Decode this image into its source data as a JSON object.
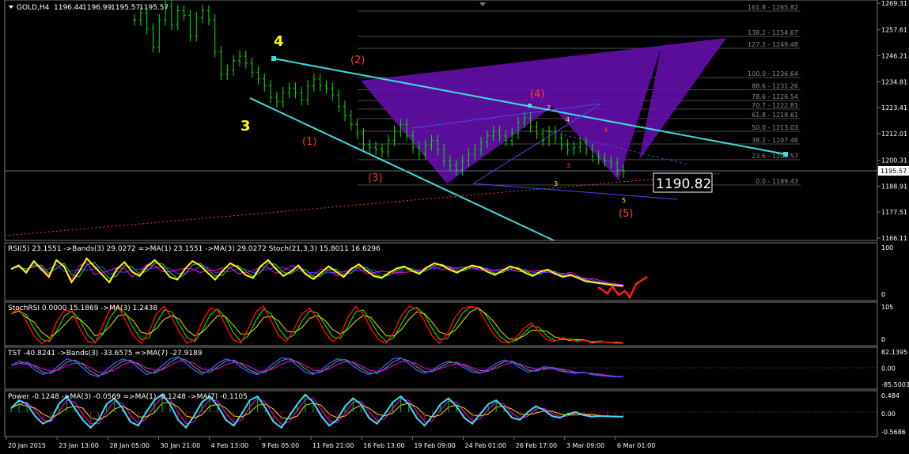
{
  "chart_data": {
    "type": "line",
    "symbol": "GOLD,H4",
    "header": {
      "title": "GOLD,H4",
      "ohlc": [
        "1196.44",
        "1196.99",
        "1195.57",
        "1195.57"
      ]
    },
    "price_axis": {
      "ylim": [
        1166.11,
        1269.31
      ],
      "ticks": [
        "1269.31",
        "1257.61",
        "1246.21",
        "1234.81",
        "1223.41",
        "1212.01",
        "1200.31",
        "1188.91",
        "1177.51",
        "1166.11"
      ]
    },
    "current_price": "1195.57",
    "big_price_label": "1190.82",
    "fib_levels": [
      {
        "label": "161.8 - 1265.82",
        "value": 1265.82
      },
      {
        "label": "138.2 - 1254.67",
        "value": 1254.67
      },
      {
        "label": "127.2 - 1249.48",
        "value": 1249.48
      },
      {
        "label": "100.0 - 1236.64",
        "value": 1236.64
      },
      {
        "label": "88.6 - 1231.26",
        "value": 1231.26
      },
      {
        "label": "78.6 - 1226.54",
        "value": 1226.54
      },
      {
        "label": "70.7 - 1222.81",
        "value": 1222.81
      },
      {
        "label": "61.8 - 1218.61",
        "value": 1218.61
      },
      {
        "label": "50.0 - 1213.03",
        "value": 1213.03
      },
      {
        "label": "38.2 - 1207.46",
        "value": 1207.46
      },
      {
        "label": "23.6 - 1200.57",
        "value": 1200.57
      },
      {
        "label": "0.0 - 1189.43",
        "value": 1189.43
      }
    ],
    "price_series": [
      1262,
      1265,
      1258,
      1250,
      1262,
      1268,
      1260,
      1266,
      1264,
      1255,
      1263,
      1266,
      1262,
      1248,
      1238,
      1240,
      1244,
      1246,
      1243,
      1239,
      1236,
      1233,
      1228,
      1226,
      1230,
      1232,
      1230,
      1227,
      1233,
      1236,
      1233,
      1232,
      1229,
      1224,
      1220,
      1216,
      1212,
      1207,
      1206,
      1205,
      1204,
      1209,
      1213,
      1216,
      1211,
      1206,
      1203,
      1207,
      1209,
      1205,
      1200,
      1198,
      1196,
      1200,
      1203,
      1205,
      1208,
      1211,
      1213,
      1211,
      1209,
      1212,
      1217,
      1219,
      1215,
      1212,
      1209,
      1213,
      1210,
      1207,
      1205,
      1206,
      1208,
      1205,
      1202,
      1201,
      1200,
      1199,
      1196,
      1195
    ],
    "x_axis_labels": [
      "20 Jan 2015",
      "23 Jan 13:00",
      "28 Jan 05:00",
      "30 Jan 21:00",
      "4 Feb 13:00",
      "9 Feb 05:00",
      "11 Feb 21:00",
      "16 Feb 13:00",
      "19 Feb 09:00",
      "24 Feb 01:00",
      "26 Feb 17:00",
      "3 Mar 09:00",
      "6 Mar 01:00"
    ],
    "wave_labels": {
      "main": [
        "4",
        "3"
      ],
      "secondary": [
        "(2)",
        "(1)",
        "(3)",
        "(4)",
        "(5)"
      ],
      "minor": [
        "2",
        "4",
        "3",
        "5"
      ],
      "minor_red": [
        "4",
        "3"
      ]
    },
    "indicators": [
      {
        "name": "RSI",
        "label": "RSI(5) 23.1551  ->Bands(3) 29.0272  =>MA(1) 23.1551  ->MA(3) 29.0272  Stoch(21,3,3) 15.8011 16.6296",
        "axis": [
          "100",
          "0"
        ],
        "main_color": "#ffff00",
        "extra_colors": [
          "#3cc83c",
          "#4646ff",
          "#ff00ff"
        ],
        "series": [
          55,
          62,
          48,
          70,
          55,
          40,
          72,
          60,
          30,
          50,
          75,
          60,
          45,
          30,
          55,
          68,
          50,
          42,
          60,
          72,
          58,
          40,
          35,
          55,
          70,
          62,
          48,
          35,
          52,
          66,
          58,
          44,
          38,
          60,
          72,
          56,
          42,
          50,
          62,
          45,
          36,
          48,
          60,
          50,
          40,
          55,
          64,
          52,
          42,
          38,
          48,
          56,
          60,
          52,
          46,
          58,
          66,
          62,
          54,
          48,
          56,
          62,
          58,
          50,
          44,
          52,
          60,
          56,
          48,
          42,
          50,
          54,
          46,
          40,
          44,
          38,
          32,
          30,
          28,
          26,
          24,
          23
        ]
      },
      {
        "name": "StochRSI",
        "label": "StochRSI 0.0000 15.1869  ->MA(3) 1.2438",
        "axis": [
          "105",
          "0"
        ],
        "main_color": "#ff0000",
        "extra_colors": [
          "#00ff00",
          "#e6e600"
        ],
        "series": [
          80,
          95,
          60,
          20,
          0,
          10,
          60,
          90,
          85,
          40,
          5,
          0,
          50,
          95,
          100,
          60,
          20,
          0,
          30,
          80,
          100,
          70,
          30,
          0,
          10,
          60,
          95,
          90,
          50,
          10,
          0,
          40,
          85,
          100,
          60,
          20,
          5,
          40,
          80,
          95,
          70,
          30,
          5,
          20,
          70,
          100,
          80,
          40,
          10,
          0,
          30,
          75,
          100,
          95,
          60,
          20,
          0,
          25,
          70,
          95,
          100,
          95,
          60,
          25,
          5,
          0,
          15,
          40,
          55,
          30,
          10,
          5,
          15,
          10,
          5,
          8,
          0,
          5,
          2,
          0,
          0
        ]
      },
      {
        "name": "TST",
        "label": "TST -40.8241  ->Bands(3) -33.6575  =>MA(7) -27.9189",
        "axis": [
          "82.1395",
          "0.00",
          "-85.5003"
        ],
        "main_color": "#4646ff",
        "extra_colors": [
          "#3cc83c",
          "#ff00ff"
        ],
        "series": [
          10,
          30,
          20,
          -10,
          -30,
          -20,
          10,
          40,
          30,
          0,
          -30,
          -40,
          -10,
          20,
          40,
          30,
          0,
          -30,
          -20,
          10,
          40,
          50,
          20,
          -10,
          -30,
          -10,
          20,
          40,
          30,
          0,
          -20,
          -30,
          -10,
          20,
          45,
          40,
          10,
          -20,
          -30,
          -10,
          20,
          40,
          35,
          10,
          -15,
          -30,
          -20,
          10,
          40,
          45,
          20,
          -10,
          -25,
          -10,
          15,
          30,
          20,
          0,
          -20,
          -25,
          -5,
          20,
          35,
          25,
          0,
          -20,
          -10,
          5,
          0,
          -15,
          -20,
          -25,
          -20,
          -30,
          -35,
          -38,
          -40,
          -41
        ]
      },
      {
        "name": "Power",
        "label": "Power -0.1248  ->MA(3) -0.0569  =>MA(1) -0.1248  ->MA(7) -0.1105",
        "axis": [
          "0.484",
          "0.00",
          "-0.5686"
        ],
        "main_color": "#3cdcff",
        "extra_colors": [
          "#ff00ff",
          "#ffd700"
        ],
        "series": [
          0.1,
          0.3,
          0.2,
          -0.1,
          -0.3,
          -0.2,
          0.2,
          0.4,
          0.1,
          -0.2,
          -0.4,
          -0.2,
          0.2,
          0.35,
          0.1,
          -0.25,
          -0.35,
          0.0,
          0.3,
          0.45,
          0.2,
          -0.2,
          -0.4,
          -0.1,
          0.25,
          0.4,
          0.15,
          -0.2,
          -0.35,
          -0.05,
          0.3,
          0.4,
          0.1,
          -0.25,
          -0.4,
          -0.1,
          0.2,
          0.45,
          0.25,
          -0.1,
          -0.35,
          -0.2,
          0.15,
          0.35,
          0.2,
          -0.15,
          -0.3,
          -0.05,
          0.25,
          0.4,
          0.2,
          -0.15,
          -0.35,
          -0.1,
          0.2,
          0.35,
          0.15,
          -0.15,
          -0.3,
          -0.05,
          0.2,
          0.3,
          0.1,
          -0.15,
          -0.2,
          0.0,
          0.15,
          0.05,
          -0.1,
          -0.15,
          -0.05,
          0.0,
          -0.08,
          -0.12,
          -0.1,
          -0.11,
          -0.12,
          -0.12
        ]
      }
    ]
  }
}
